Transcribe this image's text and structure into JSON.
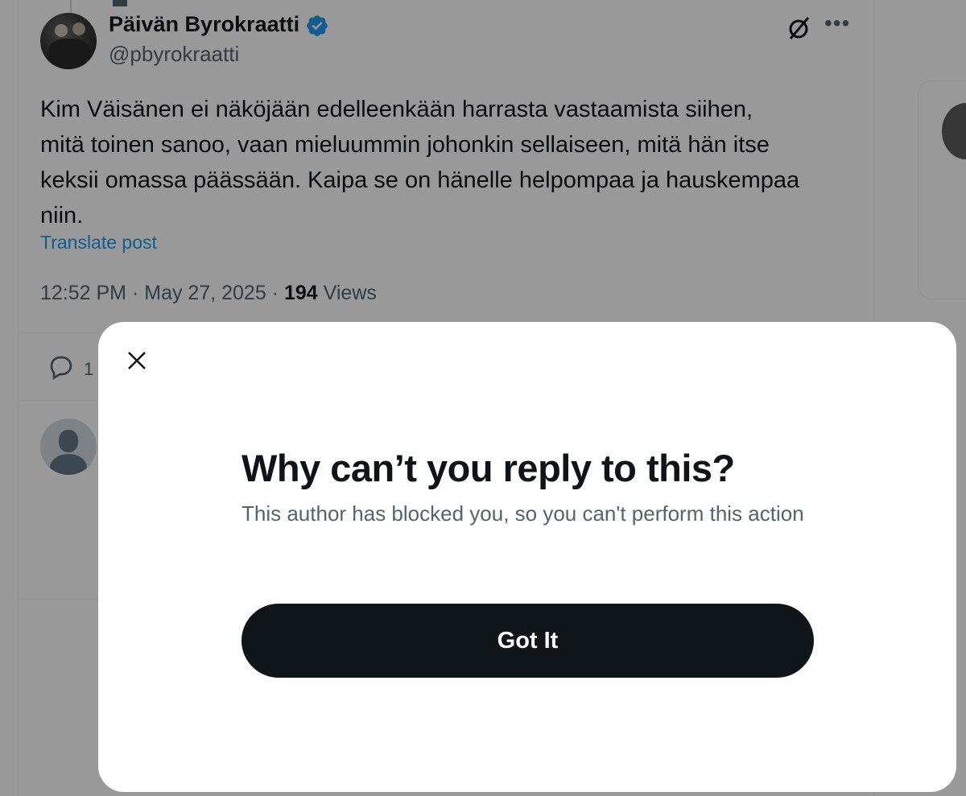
{
  "tweet": {
    "author_name": "Päivän Byrokraatti",
    "handle": "@pbyrokraatti",
    "text": "Kim Väisänen ei näköjään edelleenkään harrasta vastaamista siihen,\nmitä toinen sanoo, vaan mieluummin johonkin sellaiseen, mitä hän itse\nkeksii omassa päässään. Kaipa se on hänelle helpompaa ja hauskempaa\nniin.",
    "translate_label": "Translate post",
    "time": "12:52 PM",
    "date": "May 27, 2025",
    "views_count": "194",
    "views_label": "Views",
    "reply_count": "1"
  },
  "modal": {
    "title": "Why can’t you reply to this?",
    "body": "This author has blocked you, so you can't perform this action",
    "button_label": "Got It"
  },
  "colors": {
    "accent": "#1d9bf0",
    "text_primary": "#0f1419",
    "text_secondary": "#536471",
    "button_bg": "#0f1419",
    "overlay": "rgba(0,0,0,0.4)"
  },
  "icons": {
    "verified": "verified-badge-icon",
    "grok": "grok-icon",
    "more": "more-icon",
    "reply": "reply-icon",
    "close": "close-icon"
  }
}
